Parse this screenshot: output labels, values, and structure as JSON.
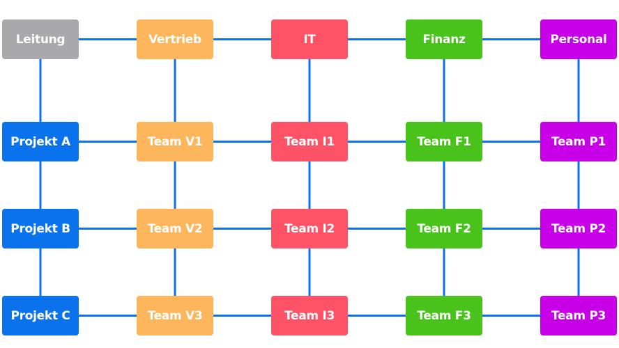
{
  "line_color": "#0a72ec",
  "columns": [
    {
      "id": "leitung",
      "color": "#a9a9ad",
      "header": "Leitung",
      "teams": [
        "Projekt A",
        "Projekt B",
        "Projekt C"
      ],
      "team_color": "#0a72ec"
    },
    {
      "id": "vertrieb",
      "color": "#fdb65c",
      "header": "Vertrieb",
      "teams": [
        "Team V1",
        "Team V2",
        "Team V3"
      ],
      "team_color": "#fdb65c"
    },
    {
      "id": "it",
      "color": "#fe5266",
      "header": "IT",
      "teams": [
        "Team I1",
        "Team I2",
        "Team I3"
      ],
      "team_color": "#fe5266"
    },
    {
      "id": "finanz",
      "color": "#49c21c",
      "header": "Finanz",
      "teams": [
        "Team F1",
        "Team F2",
        "Team F3"
      ],
      "team_color": "#49c21c"
    },
    {
      "id": "personal",
      "color": "#c800e8",
      "header": "Personal",
      "teams": [
        "Team P1",
        "Team P2",
        "Team P3"
      ],
      "team_color": "#c800e8"
    }
  ]
}
